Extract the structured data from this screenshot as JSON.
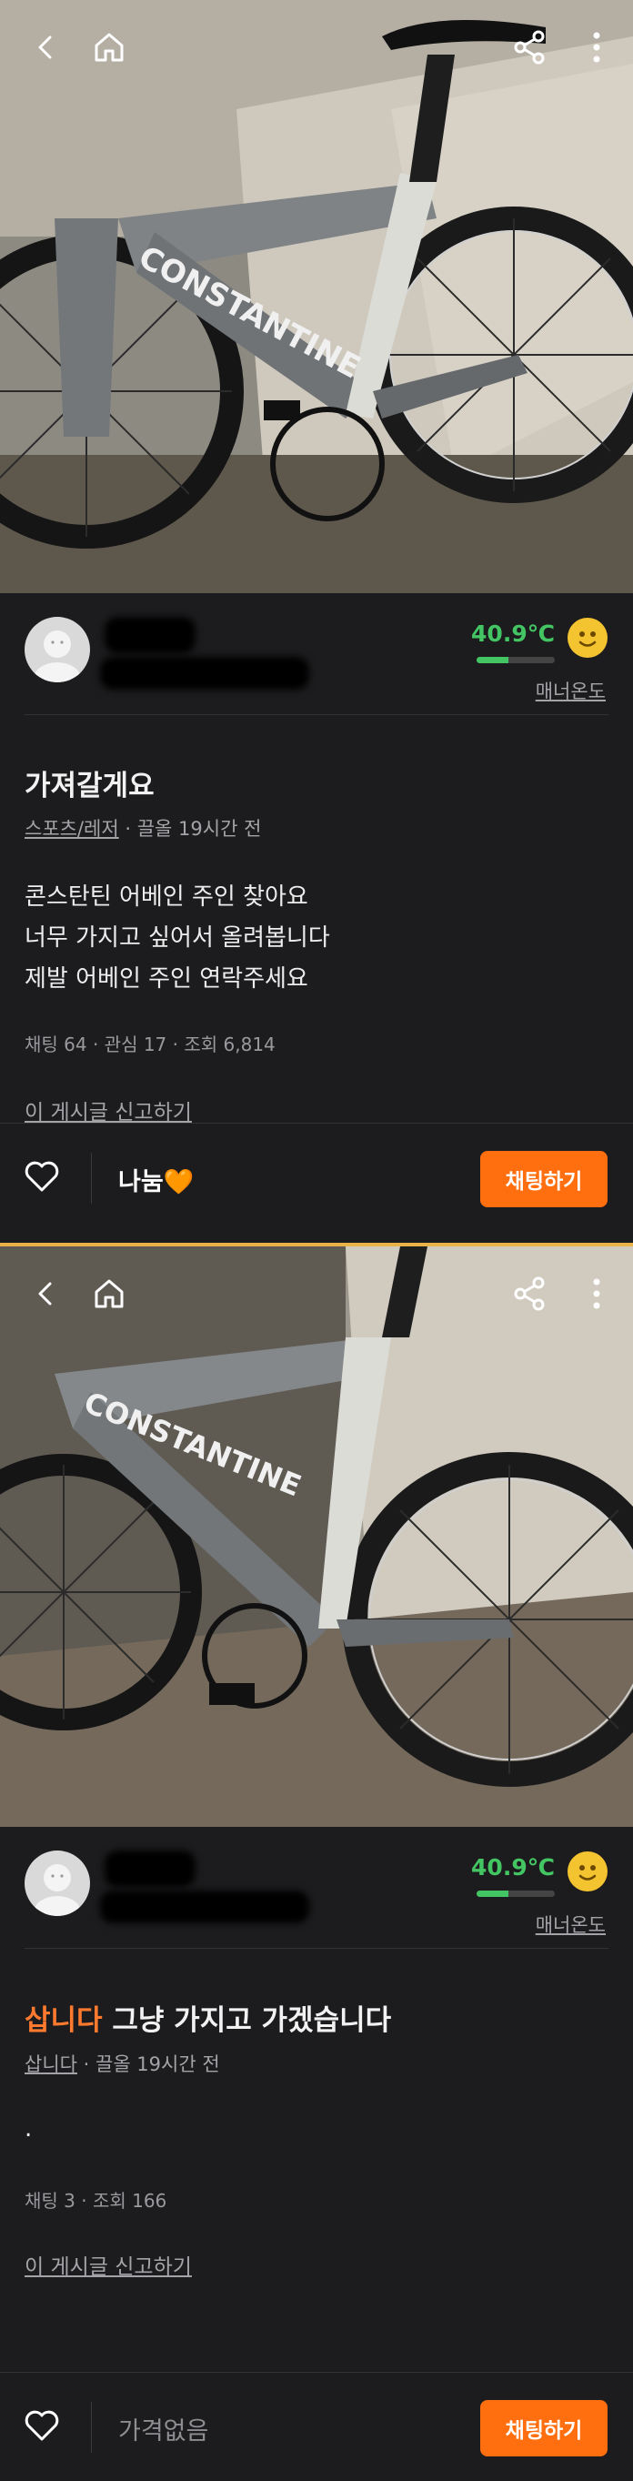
{
  "colors": {
    "accent": "#ff6f0f",
    "temperature": "#44c563",
    "background": "#1c1c1e"
  },
  "posts": [
    {
      "seller": {
        "temperature": "40.9℃",
        "temperature_level": 0.409,
        "manner_label": "매너온도"
      },
      "title": "가져갈게요",
      "category": "스포츠/레저",
      "posted": " · 끌올 19시간 전",
      "body": [
        "콘스탄틴 어베인 주인 찾아요",
        "너무 가지고 싶어서 올려봅니다",
        "제발 어베인 주인 연락주세요"
      ],
      "stats": "채팅 64 · 관심 17 · 조회 6,814",
      "report": "이 게시글 신고하기",
      "price": "나눔🧡",
      "chat_button": "채팅하기",
      "photo_brand_text": "CONSTANTINE"
    },
    {
      "seller": {
        "temperature": "40.9℃",
        "temperature_level": 0.409,
        "manner_label": "매너온도"
      },
      "title_accent": "삽니다",
      "title_rest": " 그냥 가지고 가겠습니다",
      "category": "삽니다",
      "posted": " · 끌올 19시간 전",
      "body": [
        "."
      ],
      "stats": "채팅 3 · 조회 166",
      "report": "이 게시글 신고하기",
      "price": "가격없음",
      "chat_button": "채팅하기",
      "photo_brand_text": "CONSTANTINE"
    }
  ],
  "icons": [
    "back-icon",
    "home-icon",
    "share-icon",
    "more-icon",
    "heart-icon",
    "smiley-icon"
  ]
}
